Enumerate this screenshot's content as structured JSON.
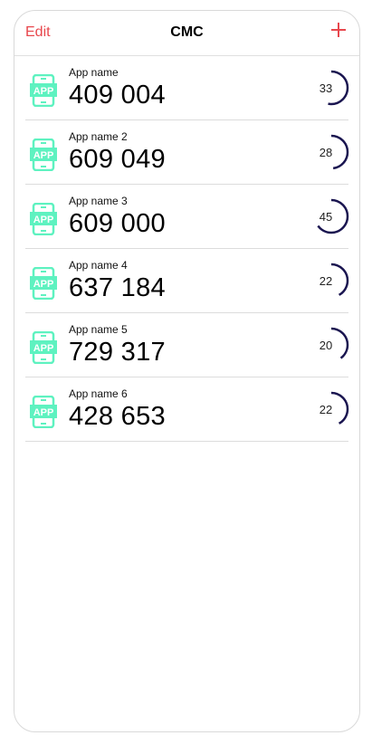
{
  "navbar": {
    "edit_label": "Edit",
    "title": "CMC",
    "add_icon": "plus-icon"
  },
  "colors": {
    "accent": "#e8474d",
    "app_icon": "#5ef2c0",
    "progress": "#1a1550"
  },
  "rows": [
    {
      "label": "App name",
      "value": "409 004",
      "progress": "33",
      "icon": "app-icon"
    },
    {
      "label": "App name 2",
      "value": "609 049",
      "progress": "28",
      "icon": "app-icon"
    },
    {
      "label": "App name 3",
      "value": "609 000",
      "progress": "45",
      "icon": "app-icon"
    },
    {
      "label": "App name 4",
      "value": "637 184",
      "progress": "22",
      "icon": "app-icon"
    },
    {
      "label": "App name 5",
      "value": "729 317",
      "progress": "20",
      "icon": "app-icon"
    },
    {
      "label": "App name 6",
      "value": "428 653",
      "progress": "22",
      "icon": "app-icon"
    }
  ]
}
